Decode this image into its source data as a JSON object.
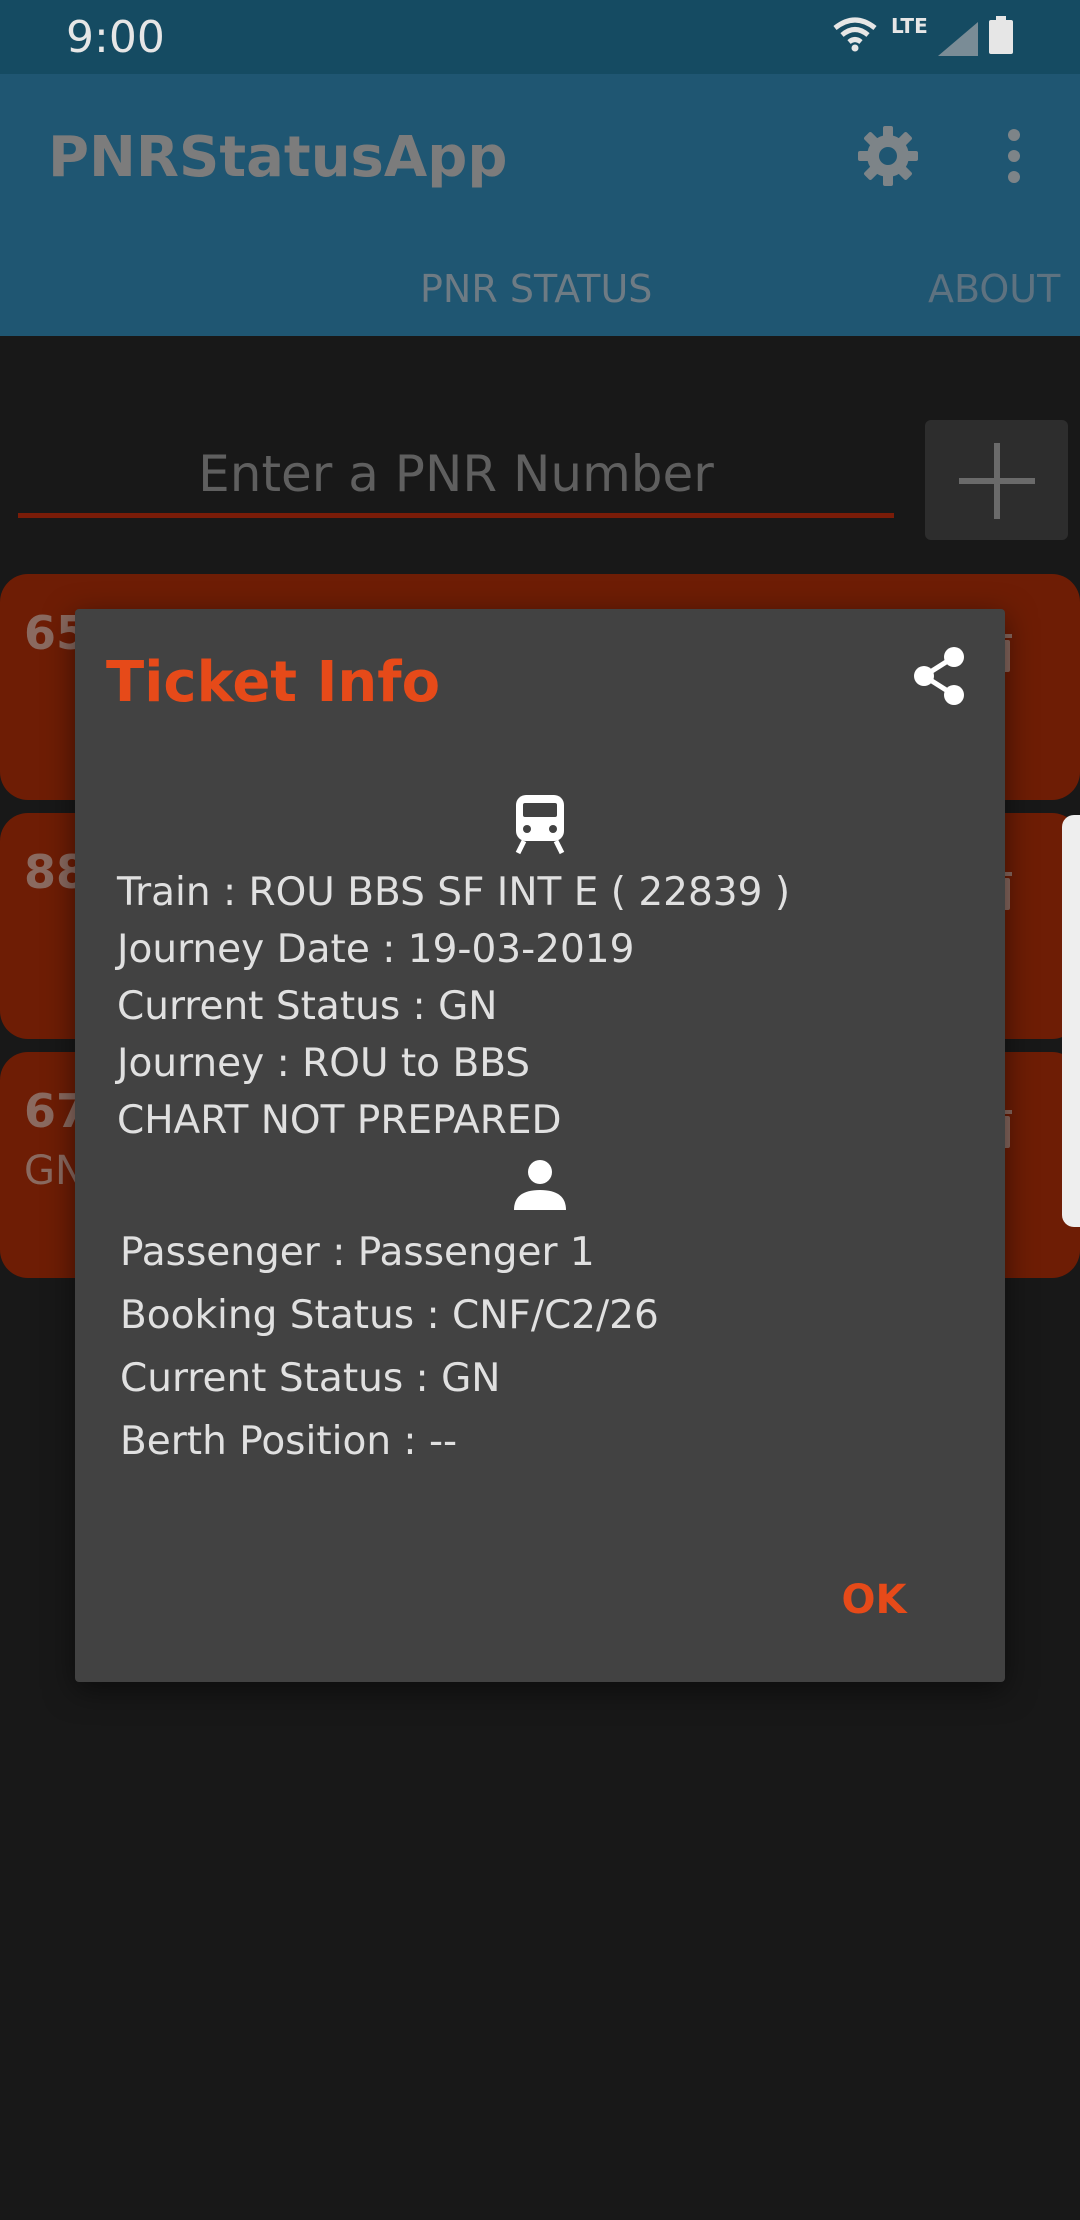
{
  "status_bar": {
    "time": "9:00",
    "network": "LTE"
  },
  "app_bar": {
    "title": "PNRStatusApp"
  },
  "tabs": [
    {
      "label": "PNR STATUS"
    },
    {
      "label": "ABOUT"
    }
  ],
  "pnr_input": {
    "placeholder": "Enter a PNR Number",
    "value": ""
  },
  "cards": [
    {
      "number_partial": "65",
      "status_partial": ""
    },
    {
      "number_partial": "88",
      "status_partial": ""
    },
    {
      "number_partial": "67",
      "status_partial": "GN"
    }
  ],
  "dialog": {
    "title": "Ticket Info",
    "train_line": "Train : ROU BBS SF INT E ( 22839 )",
    "journey_date_line": "Journey Date : 19-03-2019",
    "current_status_line": "Current Status : GN",
    "journey_line": "Journey : ROU to BBS",
    "chart_line": "CHART NOT PREPARED",
    "passenger": {
      "name_line": "Passenger : Passenger 1",
      "booking_status_line": "Booking Status : CNF/C2/26",
      "current_status_line": "Current Status : GN",
      "berth_line": "Berth Position : --"
    },
    "ok_label": "OK"
  },
  "colors": {
    "accent": "#e64a19",
    "app_bar": "#1f5672",
    "card": "#6e1d05",
    "dialog_bg": "#424242"
  },
  "icons": [
    "wifi-icon",
    "signal-icon",
    "battery-icon",
    "gear-icon",
    "overflow-menu-icon",
    "plus-icon",
    "share-icon",
    "train-icon",
    "person-icon",
    "trash-icon"
  ]
}
